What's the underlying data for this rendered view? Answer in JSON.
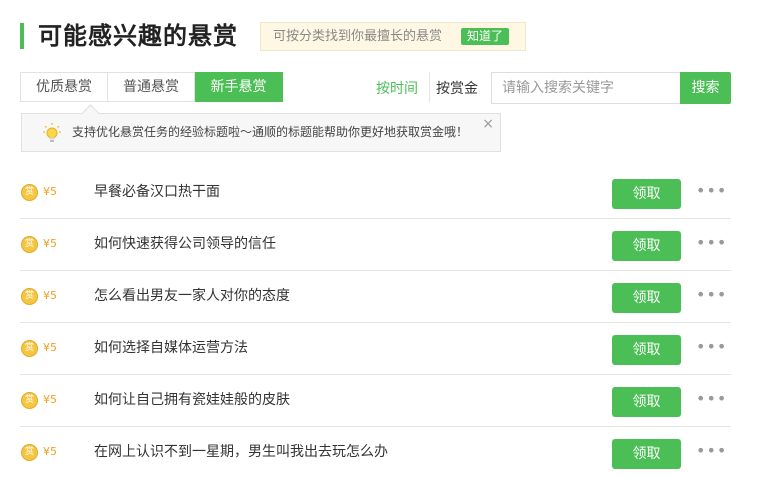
{
  "header": {
    "title": "可能感兴趣的悬赏",
    "hint": "可按分类找到你最擅长的悬赏",
    "hint_button": "知道了"
  },
  "tabs": [
    {
      "label": "优质悬赏",
      "active": false
    },
    {
      "label": "普通悬赏",
      "active": false
    },
    {
      "label": "新手悬赏",
      "active": true
    }
  ],
  "sort": {
    "by_time": "按时间",
    "by_bounty": "按赏金"
  },
  "search": {
    "placeholder": "请输入搜索关键字",
    "button": "搜索"
  },
  "tip": {
    "text": "支持优化悬赏任务的经验标题啦～通顺的标题能帮助你更好地获取赏金哦！",
    "close": "×"
  },
  "list": {
    "coin_glyph": "赏",
    "claim_label": "领取",
    "more_label": "•••",
    "items": [
      {
        "amount": "¥5",
        "question": "早餐必备汉口热干面"
      },
      {
        "amount": "¥5",
        "question": "如何快速获得公司领导的信任"
      },
      {
        "amount": "¥5",
        "question": "怎么看出男友一家人对你的态度"
      },
      {
        "amount": "¥5",
        "question": "如何选择自媒体运营方法"
      },
      {
        "amount": "¥5",
        "question": "如何让自己拥有瓷娃娃般的皮肤"
      },
      {
        "amount": "¥5",
        "question": "在网上认识不到一星期，男生叫我出去玩怎么办"
      }
    ]
  },
  "colors": {
    "accent": "#4bbf55",
    "coin": "#f6c640",
    "amount": "#f0a020",
    "hint_bg": "#fdf7e4"
  }
}
